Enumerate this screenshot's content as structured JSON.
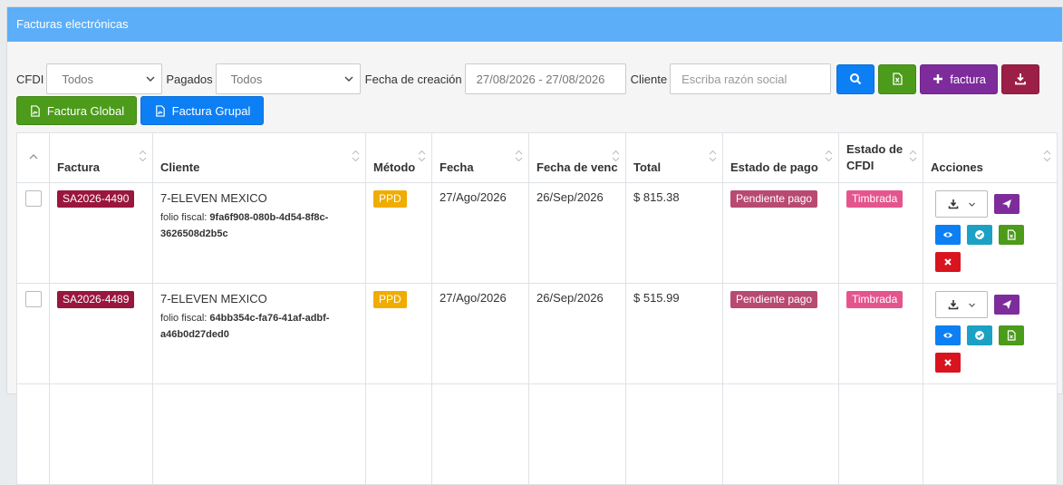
{
  "panel": {
    "title": "Facturas electrónicas"
  },
  "filters": {
    "cfdi_label": "CFDI",
    "cfdi_value": "Todos",
    "pagados_label": "Pagados",
    "pagados_value": "Todos",
    "fecha_label": "Fecha de creación",
    "fecha_value": "27/08/2026 - 27/08/2026",
    "cliente_label": "Cliente",
    "cliente_placeholder": "Escriba razón social",
    "add_factura_label": "factura"
  },
  "buttons": {
    "factura_global": "Factura Global",
    "factura_grupal": "Factura Grupal"
  },
  "table": {
    "headers": {
      "factura": "Factura",
      "cliente": "Cliente",
      "metodo": "Método",
      "fecha": "Fecha",
      "fecha_venc": "Fecha de venc",
      "total": "Total",
      "estado_pago": "Estado de pago",
      "estado_cfdi_1": "Estado de",
      "estado_cfdi_2": "CFDI",
      "acciones": "Acciones"
    },
    "rows": [
      {
        "factura": "SA2026-4490",
        "cliente": "7-ELEVEN MEXICO",
        "folio_label": "folio fiscal:",
        "folio_1": "9fa6f908-080b-4d54-8f8c-",
        "folio_2": "3626508d2b5c",
        "metodo": "PPD",
        "fecha": "27/Ago/2026",
        "fecha_venc": "26/Sep/2026",
        "total": "$ 815.38",
        "estado_pago": "Pendiente pago",
        "estado_cfdi": "Timbrada"
      },
      {
        "factura": "SA2026-4489",
        "cliente": "7-ELEVEN MEXICO",
        "folio_label": "folio fiscal:",
        "folio_1": "64bb354c-fa76-41af-adbf-",
        "folio_2": "a46b0d27ded0",
        "metodo": "PPD",
        "fecha": "27/Ago/2026",
        "fecha_venc": "26/Sep/2026",
        "total": "$ 515.99",
        "estado_pago": "Pendiente pago",
        "estado_cfdi": "Timbrada"
      }
    ]
  },
  "colors": {
    "header_bar": "#5caef8",
    "primary": "#0d7ff5",
    "success": "#4c9b1b",
    "purple": "#7e2b9c",
    "maroon": "#9c1f47",
    "warning": "#f0ad00",
    "danger": "#d9141f"
  },
  "icons": [
    "search-icon",
    "excel-icon",
    "plus-icon",
    "download-icon",
    "pdf-icon",
    "chevron-down-icon",
    "send-icon",
    "eye-icon",
    "check-circle-icon",
    "file-icon",
    "close-icon",
    "sort-icon"
  ]
}
